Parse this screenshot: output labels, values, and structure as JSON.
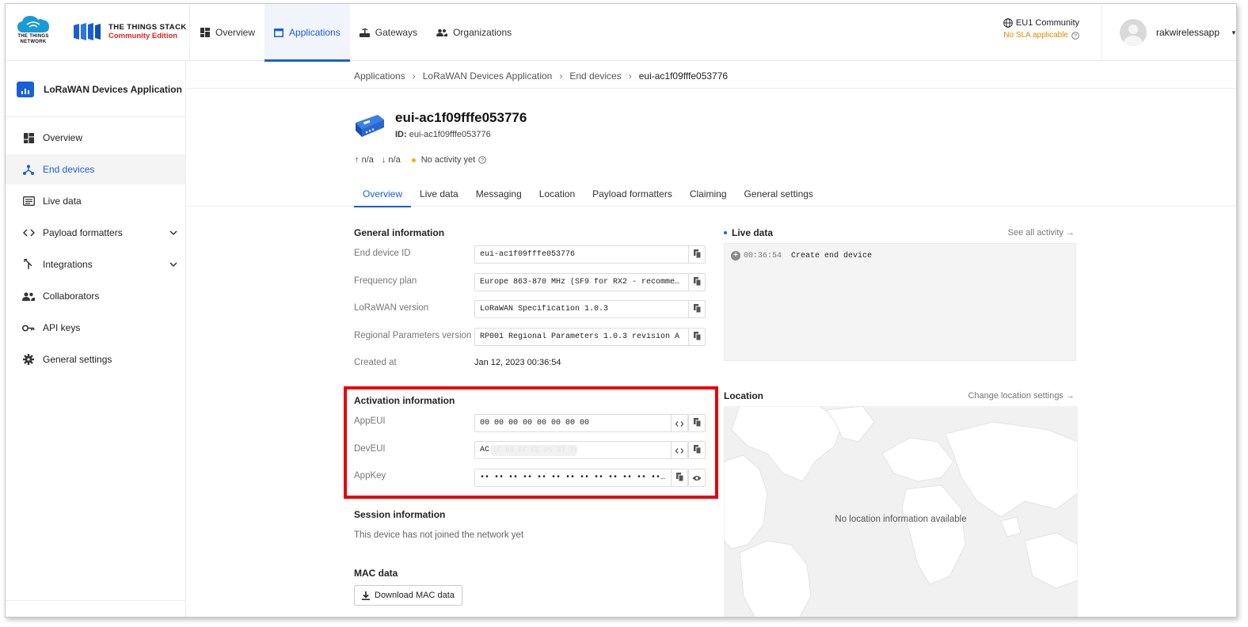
{
  "brand": {
    "ttn_line1": "THE THINGS",
    "ttn_line2": "NETWORK",
    "stack_line1": "THE THINGS STACK",
    "stack_line2": "Community Edition"
  },
  "nav": {
    "items": [
      {
        "label": "Overview",
        "icon": "dashboard-icon"
      },
      {
        "label": "Applications",
        "icon": "application-icon"
      },
      {
        "label": "Gateways",
        "icon": "gateway-icon"
      },
      {
        "label": "Organizations",
        "icon": "organizations-icon"
      }
    ],
    "active": "Applications"
  },
  "cluster": {
    "name": "EU1 Community",
    "sla": "No SLA applicable"
  },
  "user": {
    "name": "rakwirelessapp"
  },
  "sidebar": {
    "app_title": "LoRaWAN Devices Application",
    "items": [
      {
        "label": "Overview",
        "icon": "dashboard-icon"
      },
      {
        "label": "End devices",
        "icon": "devices-icon"
      },
      {
        "label": "Live data",
        "icon": "live-data-icon"
      },
      {
        "label": "Payload formatters",
        "icon": "code-icon"
      },
      {
        "label": "Integrations",
        "icon": "integrations-icon"
      },
      {
        "label": "Collaborators",
        "icon": "collaborators-icon"
      },
      {
        "label": "API keys",
        "icon": "key-icon"
      },
      {
        "label": "General settings",
        "icon": "gear-icon"
      }
    ],
    "active": "End devices"
  },
  "breadcrumb": [
    "Applications",
    "LoRaWAN Devices Application",
    "End devices",
    "eui-ac1f09fffe053776"
  ],
  "device": {
    "title": "eui-ac1f09fffe053776",
    "id_label": "ID:",
    "id_value": "eui-ac1f09fffe053776",
    "uplink": "n/a",
    "downlink": "n/a",
    "activity": "No activity yet"
  },
  "tabs": [
    "Overview",
    "Live data",
    "Messaging",
    "Location",
    "Payload formatters",
    "Claiming",
    "General settings"
  ],
  "active_tab": "Overview",
  "general": {
    "title": "General information",
    "end_device_id_label": "End device ID",
    "end_device_id": "eui-ac1f09fffe053776",
    "frequency_plan_label": "Frequency plan",
    "frequency_plan": "Europe 863-870 MHz (SF9 for RX2 - recommended)",
    "lorawan_version_label": "LoRaWAN version",
    "lorawan_version": "LoRaWAN Specification 1.0.3",
    "regional_params_label": "Regional Parameters version",
    "regional_params": "RP001 Regional Parameters 1.0.3 revision A",
    "created_at_label": "Created at",
    "created_at": "Jan 12, 2023 00:36:54"
  },
  "activation": {
    "title": "Activation information",
    "appeui_label": "AppEUI",
    "appeui": "00 00 00 00 00 00 00 00",
    "deveui_label": "DevEUI",
    "deveui_prefix": "AC",
    "deveui_masked": "1F 09 FF FE 05 37 76",
    "appkey_label": "AppKey",
    "appkey_masked": "•• •• •• •• •• •• •• •• •• •• •• •• •• •• •• ••"
  },
  "session": {
    "title": "Session information",
    "text": "This device has not joined the network yet"
  },
  "mac": {
    "title": "MAC data",
    "button": "Download MAC data"
  },
  "live_data": {
    "title": "Live data",
    "link": "See all activity →",
    "events": [
      {
        "time": "00:36:54",
        "text": "Create end device"
      }
    ]
  },
  "location": {
    "title": "Location",
    "link": "Change location settings →",
    "empty": "No location information available"
  },
  "colors": {
    "accent": "#1a5fd6",
    "highlight": "#e8000b",
    "warning": "#e08a00"
  }
}
